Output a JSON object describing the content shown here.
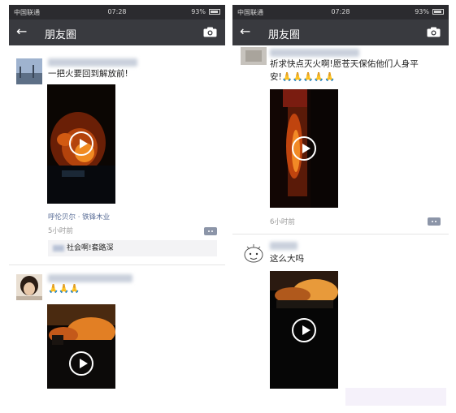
{
  "statusbar": {
    "carrier": "中国联通",
    "time": "07:28",
    "battery": "93%"
  },
  "navbar": {
    "back_icon": "←",
    "title": "朋友圈"
  },
  "left": {
    "post1": {
      "text": "一把火要回到解放前!",
      "location": "呼伦贝尔 · 铁锋木业",
      "time_ago": "5小时前",
      "comment": "社会啊!套路深"
    },
    "post2": {
      "text": "🙏🙏🙏"
    }
  },
  "right": {
    "post1": {
      "text_line1": "祈求快点灭火啊!愿苍天保佑他们人身平",
      "text_line2": "安!🙏🙏🙏🙏🙏",
      "time_ago": "6小时前"
    },
    "post2": {
      "text": "这么大吗"
    }
  },
  "icons": {
    "back": "arrow-left",
    "camera": "camera",
    "play": "play",
    "comment": "comment"
  }
}
